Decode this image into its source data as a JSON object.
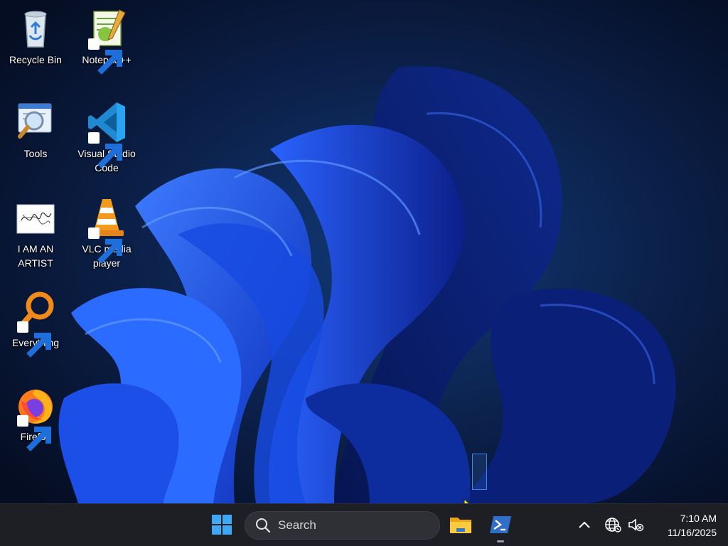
{
  "desktop": {
    "icons": [
      {
        "label": "Recycle Bin",
        "icon": "recycle-bin-icon",
        "shortcut": false
      },
      {
        "label": "Notepad++",
        "icon": "notepad-plus-plus-icon",
        "shortcut": true
      },
      {
        "label": "Tools",
        "icon": "tools-folder-icon",
        "shortcut": false
      },
      {
        "label": "Visual Studio Code",
        "icon": "vscode-icon",
        "shortcut": true
      },
      {
        "label": "I AM AN ARTIST",
        "icon": "artist-image-icon",
        "shortcut": false
      },
      {
        "label": "VLC media player",
        "icon": "vlc-icon",
        "shortcut": true
      },
      {
        "label": "Everything",
        "icon": "everything-search-icon",
        "shortcut": true
      },
      {
        "label": "Firefox",
        "icon": "firefox-icon",
        "shortcut": true
      }
    ]
  },
  "taskbar": {
    "search_placeholder": "Search",
    "pinned": [
      {
        "name": "start",
        "icon": "windows-logo-icon"
      },
      {
        "name": "file-explorer",
        "icon": "folder-icon"
      },
      {
        "name": "terminal",
        "icon": "powershell-icon"
      }
    ],
    "tray": {
      "chevron": "chevron-up-icon",
      "network": "globe-icon",
      "volume": "volume-muted-icon"
    },
    "clock": {
      "time": "7:10 AM",
      "date": "11/16/2025"
    }
  },
  "colors": {
    "taskbar_bg": "#1d1f24",
    "accent": "#3d86e6",
    "wallpaper_dark": "#06102a",
    "bloom_blue": "#1a4fe0"
  }
}
